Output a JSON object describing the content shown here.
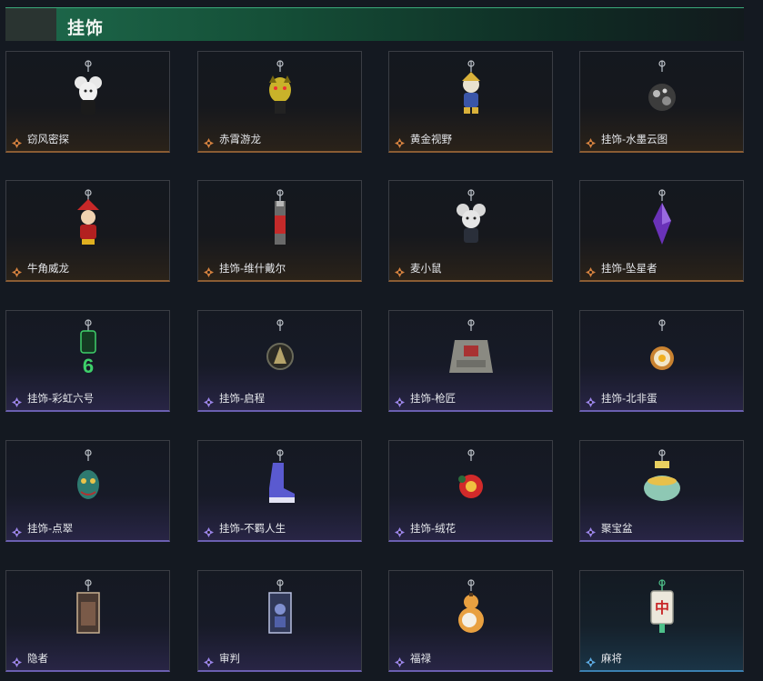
{
  "header": {
    "title": "挂饰"
  },
  "colors": {
    "gold": "#d4813f",
    "purple": "#9a84e8",
    "blue": "#5aa8e0",
    "header_green": "#1e6a4c"
  },
  "items": [
    {
      "label": "窃风密探",
      "rarity": "gold",
      "icon": "mouse-charm-icon"
    },
    {
      "label": "赤霄游龙",
      "rarity": "gold",
      "icon": "dragon-head-charm-icon"
    },
    {
      "label": "黄金视野",
      "rarity": "gold",
      "icon": "gold-figure-charm-icon"
    },
    {
      "label": "挂饰-水墨云图",
      "rarity": "gold",
      "icon": "ink-ball-charm-icon"
    },
    {
      "label": "牛角威龙",
      "rarity": "gold",
      "icon": "red-hat-figure-charm-icon"
    },
    {
      "label": "挂饰-维什戴尔",
      "rarity": "gold",
      "icon": "blade-charm-icon"
    },
    {
      "label": "麦小鼠",
      "rarity": "gold",
      "icon": "mouse-doll-charm-icon"
    },
    {
      "label": "挂饰-坠星者",
      "rarity": "gold",
      "icon": "purple-crystal-charm-icon"
    },
    {
      "label": "挂饰-彩虹六号",
      "rarity": "purple",
      "icon": "green-six-charm-icon"
    },
    {
      "label": "挂饰-启程",
      "rarity": "purple",
      "icon": "round-emblem-charm-icon"
    },
    {
      "label": "挂饰-枪匠",
      "rarity": "purple",
      "icon": "vest-charm-icon"
    },
    {
      "label": "挂饰-北非蛋",
      "rarity": "purple",
      "icon": "egg-dish-charm-icon"
    },
    {
      "label": "挂饰-点翠",
      "rarity": "purple",
      "icon": "teal-mask-charm-icon"
    },
    {
      "label": "挂饰-不羁人生",
      "rarity": "purple",
      "icon": "sneaker-charm-icon"
    },
    {
      "label": "挂饰-绒花",
      "rarity": "purple",
      "icon": "red-flower-charm-icon"
    },
    {
      "label": "聚宝盆",
      "rarity": "purple",
      "icon": "treasure-bowl-charm-icon"
    },
    {
      "label": "隐者",
      "rarity": "purple",
      "icon": "hermit-card-charm-icon"
    },
    {
      "label": "审判",
      "rarity": "purple",
      "icon": "judgment-card-charm-icon"
    },
    {
      "label": "福禄",
      "rarity": "purple",
      "icon": "gourd-charm-icon"
    },
    {
      "label": "麻将",
      "rarity": "blue",
      "icon": "mahjong-tile-charm-icon"
    }
  ]
}
